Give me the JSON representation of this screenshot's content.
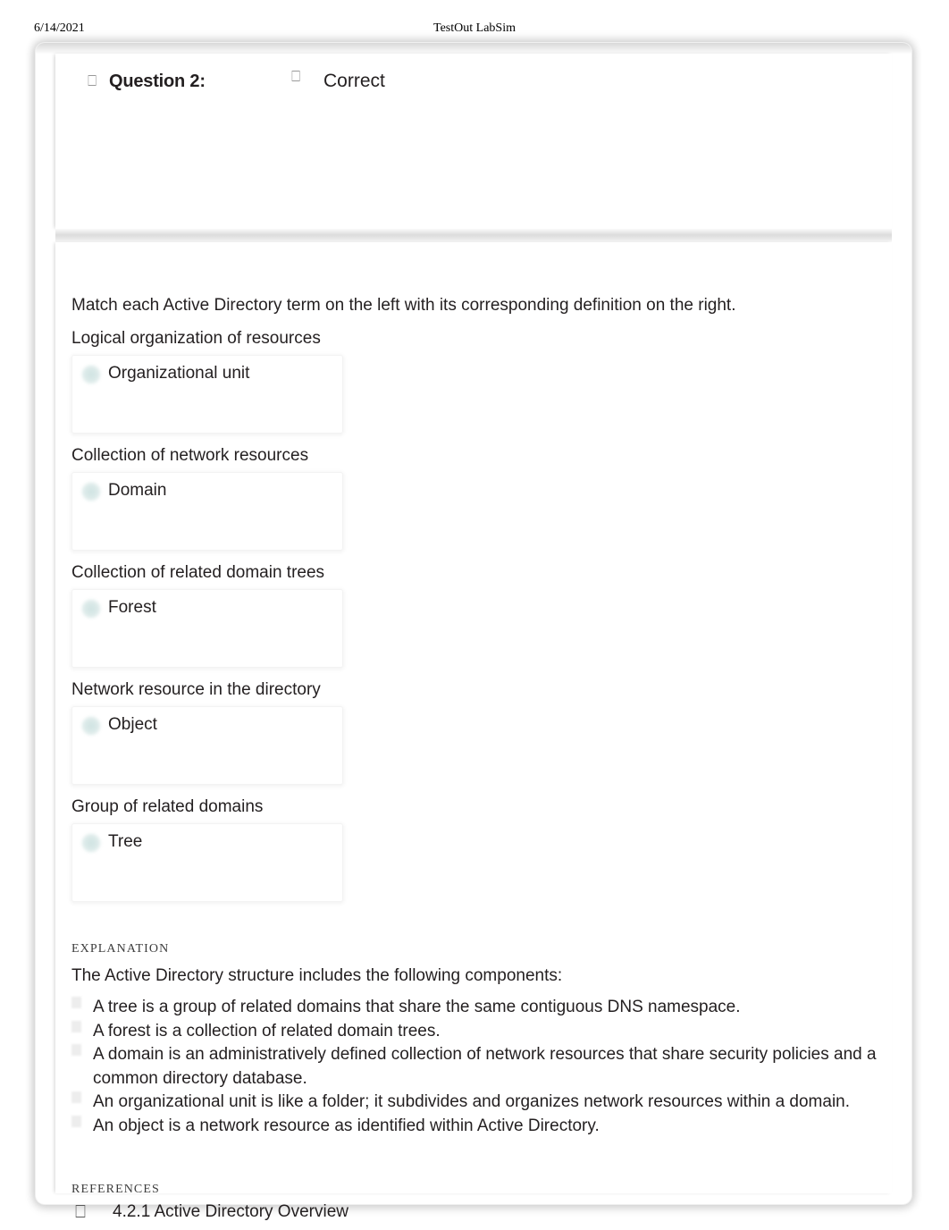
{
  "print_header": {
    "date": "6/14/2021",
    "app_title": "TestOut LabSim"
  },
  "question": {
    "label": "Question 2:",
    "status": "Correct",
    "marker_glyph": "⎕",
    "status_marker_glyph": "⎕"
  },
  "prompt": "Match each Active Directory term on the left with its corresponding definition on the right.",
  "matches": [
    {
      "definition": "Logical organization of resources",
      "term": "Organizational unit"
    },
    {
      "definition": "Collection of network resources",
      "term": "Domain"
    },
    {
      "definition": "Collection of related domain trees",
      "term": "Forest"
    },
    {
      "definition": "Network resource in the directory",
      "term": "Object"
    },
    {
      "definition": "Group of related domains",
      "term": "Tree"
    }
  ],
  "explanation": {
    "heading": "EXPLANATION",
    "intro": "The Active Directory structure includes the following components:",
    "bullets": [
      "A tree is a group of related domains that share the same contiguous DNS namespace.",
      "A forest is a collection of related domain trees.",
      "A domain is an administratively defined collection of network resources that share security policies and a common directory database.",
      "An organizational unit is like a folder; it subdivides and organizes network resources within a domain.",
      "An object is a network resource as identified within Active Directory."
    ]
  },
  "references": {
    "heading": "REFERENCES",
    "icon_glyph": "⎕",
    "items": [
      "4.2.1 Active Directory Overview"
    ]
  },
  "colors": {
    "text": "#231f20",
    "accent_dot": "#dceaea",
    "divider": "#dcdcdc",
    "muted": "#9a9a9a"
  }
}
